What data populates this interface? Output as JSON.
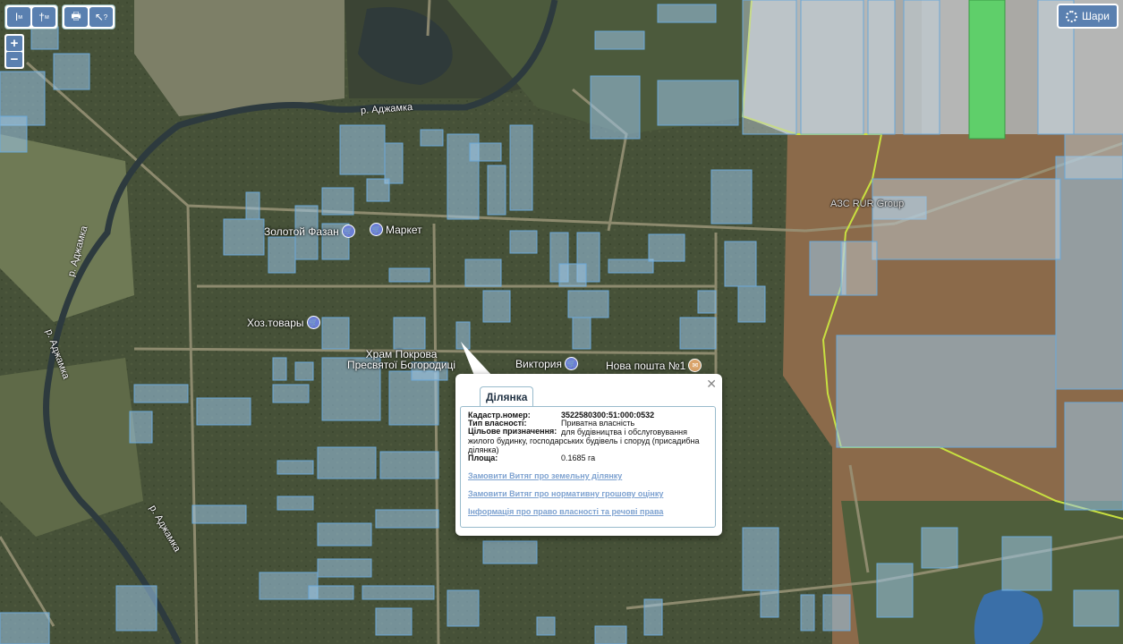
{
  "toolbar": {
    "tools": [
      {
        "name": "measure-distance-tool",
        "icon": "ruler-icon",
        "glyph": "I",
        "sub": "м"
      },
      {
        "name": "measure-area-tool",
        "icon": "area-icon",
        "glyph": "†",
        "sub": "м"
      },
      {
        "name": "print-tool",
        "icon": "print-icon",
        "glyph": "🖶",
        "sub": ""
      },
      {
        "name": "info-tool",
        "icon": "cursor-help-icon",
        "glyph": "↖",
        "sub": "?"
      }
    ],
    "zoom_in": "+",
    "zoom_out": "−"
  },
  "layers_button": {
    "label": "Шари",
    "icon": "gear-icon"
  },
  "map_labels": {
    "river_1": "р. Аджамка",
    "river_2": "р. Аджамка",
    "river_3": "р. Аджамка",
    "river_4": "р. Аджамка",
    "gas_station": "АЗС RUR Group"
  },
  "pois": [
    {
      "id": "zolotoi-fazan",
      "label": "Золотой Фазан",
      "icon": "shop-icon"
    },
    {
      "id": "market",
      "label": "Маркет",
      "icon": "shop-icon"
    },
    {
      "id": "hoz-tovary",
      "label": "Хоз.товары",
      "icon": "shop-icon"
    },
    {
      "id": "viktoria",
      "label": "Виктория",
      "icon": "shop-icon"
    },
    {
      "id": "nova-poshta",
      "label": "Нова пошта №1",
      "icon": "mail-icon"
    }
  ],
  "church": {
    "line1": "Храм Покрова",
    "line2": "Пресвятої Богородиці"
  },
  "popup": {
    "tab": "Ділянка",
    "rows": [
      {
        "label": "Кадастр.номер:",
        "value": "3522580300:51:000:0532",
        "bold": true
      },
      {
        "label": "Тип власності:",
        "value": "Приватна власність"
      },
      {
        "label": "Цільове призначення:",
        "value": "для будівництва і обслуговування жилого будинку, господарських будівель і споруд (присадибна ділянка)"
      },
      {
        "label": "Площа:",
        "value": "0.1685 га"
      }
    ],
    "links": [
      "Замовити Витяг про земельну ділянку",
      "Замовити Витяг про нормативну грошову оцінку",
      "Інформація про право власності та речові права"
    ]
  },
  "colors": {
    "parcel_fill": "#9cc6e8",
    "parcel_stroke": "#6aa8d8",
    "brown_zone": "#8b6a4a",
    "green_parcel": "#5fcf6a",
    "boundary_line": "#c8e040",
    "ui_button": "#5a80b0"
  }
}
